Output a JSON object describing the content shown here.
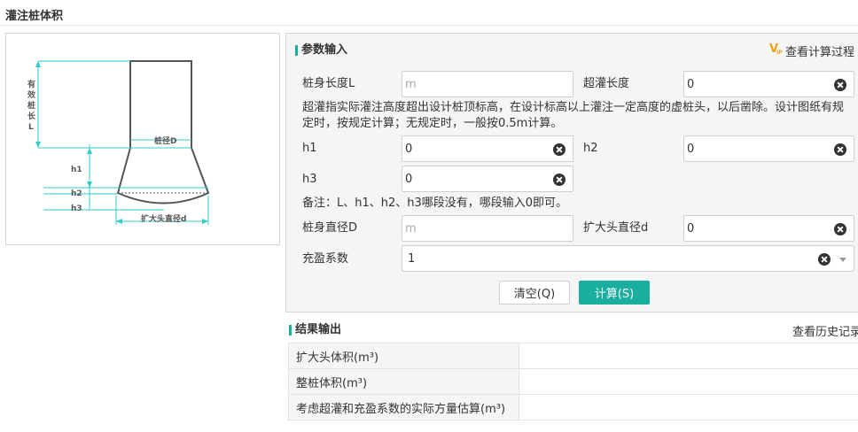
{
  "page": {
    "title": "灌注桩体积"
  },
  "diagram": {
    "label_effective_length": [
      "有",
      "效",
      "桩",
      "长",
      "L"
    ],
    "label_pile_diameter": "桩径D",
    "label_h1": "h1",
    "label_h2": "h2",
    "label_h3": "h3",
    "label_bell_diameter": "扩大头直径d"
  },
  "params": {
    "section_title": "参数输入",
    "calc_process_link": "查看计算过程",
    "pile_length": {
      "label": "桩身长度L",
      "value": "",
      "placeholder": "m"
    },
    "over_pour_length": {
      "label": "超灌长度",
      "value": "0",
      "placeholder": ""
    },
    "over_pour_note": "超灌指实际灌注高度超出设计桩顶标高，在设计标高以上灌注一定高度的虚桩头，以后凿除。设计图纸有规",
    "over_pour_note_2": "定时，按规定计算；无规定时，一般按0.5m计算。",
    "h1": {
      "label": "h1",
      "value": "0"
    },
    "h2": {
      "label": "h2",
      "value": "0"
    },
    "h3": {
      "label": "h3",
      "value": "0"
    },
    "remark": "备注：L、h1、h2、h3哪段没有，哪段输入0即可。",
    "pile_diameter": {
      "label": "桩身直径D",
      "value": "",
      "placeholder": "m"
    },
    "bell_diameter": {
      "label": "扩大头直径d",
      "value": "0"
    },
    "filling_coefficient": {
      "label": "充盈系数",
      "value": "1"
    },
    "clear_button": "清空(Q)",
    "calc_button": "计算(S)"
  },
  "results": {
    "section_title": "结果输出",
    "history_link": "查看历史记录",
    "rows": [
      {
        "label": "扩大头体积(m³)",
        "value": ""
      },
      {
        "label": "整桩体积(m³)",
        "value": ""
      },
      {
        "label": "考虑超灌和充盈系数的实际方量估算(m³)",
        "value": ""
      }
    ]
  },
  "colors": {
    "accent": "#1aae9f",
    "diagram_line": "#33cccc",
    "vip": "#e8a317"
  }
}
